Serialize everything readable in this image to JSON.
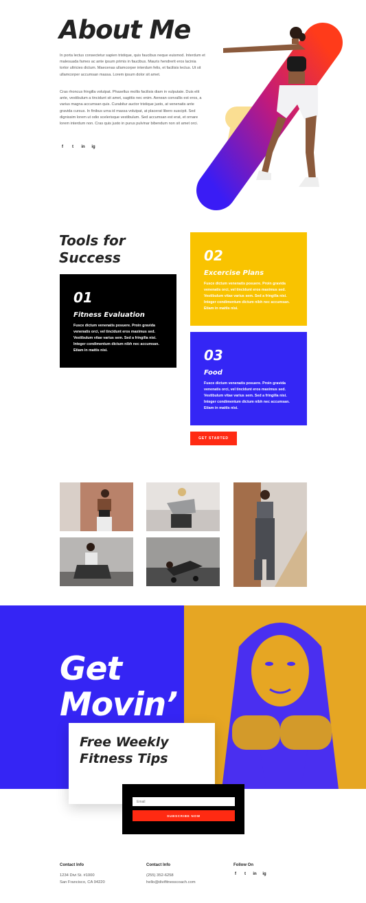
{
  "about": {
    "title": "About Me",
    "para1": "In porta lectus consectetur sapien tristique, quis faucibus neque euismod. Interdum et malesuada fames ac ante ipsum primis in faucibus. Mauris hendrerit eros lacinia tortor ultricies dictum. Maecenas ullamcorper interdum felis, et facilisis lectus. Ut sit ullamcorper accumsan massa. Lorem ipsum dolor sit amet.",
    "para2": "Cras rhoncus fringilla volutpat. Phasellus mollis facilisis diam in vulputate. Duis elit ante, vestibulum a tincidunt sit amet, sagittis nec enim. Aenean convallis est eros, a varius magna accumsan quis. Curabitur auctor tristique justo, at venenatis ante gravida cursus. In finibus urna id massa volutpat, at placerat libero suscipit. Sed dignissim lorem ut odio scelerisque vestibulum. Sed accumsan est erat, et ornare lorem interdum non. Cras quis justo in purus pulvinar bibendum non sit amet orci.",
    "social": [
      "f",
      "t",
      "in",
      "ig"
    ]
  },
  "tools": {
    "title": "Tools for Success",
    "cards": [
      {
        "num": "01",
        "title": "Fitness Evaluation",
        "text": "Fusce dictum venenatis posuere. Proin gravida venenatis orci, vel tincidunt eros maximus sed. Vestibulum vitae varius sem. Sed a fringilla nisi. Integer condimentum dictum nibh nec accumsan. Etiam in mattis nisi."
      },
      {
        "num": "02",
        "title": "Excercise Plans",
        "text": "Fusce dictum venenatis posuere. Proin gravida venenatis orci, vel tincidunt eros maximus sed. Vestibulum vitae varius sem. Sed a fringilla nisi. Integer condimentum dictum nibh nec accumsan. Etiam in mattis nisi."
      },
      {
        "num": "03",
        "title": "Food",
        "text": "Fusce dictum venenatis posuere. Proin gravida venenatis orci, vel tincidunt eros maximus sed. Vestibulum vitae varius sem. Sed a fringilla nisi. Integer condimentum dictum nibh nec accumsan. Etiam in mattis nisi."
      }
    ],
    "button": "GET STARTED"
  },
  "movin": {
    "title_line1": "Get",
    "title_line2": "Movin’",
    "tips_line1": "Free Weekly",
    "tips_line2": "Fitness Tips",
    "email_placeholder": "Email",
    "subscribe": "SUBSCRIBE NOW"
  },
  "footer": {
    "col1": {
      "head": "Contact Info",
      "line1": "1234 Divi St. #1000",
      "line2": "San Francisco, CA 94220"
    },
    "col2": {
      "head": "Contact Info",
      "line1": "(255) 352-6258",
      "line2": "hello@divifitnesscoach.com"
    },
    "col3": {
      "head": "Follow On",
      "social": [
        "f",
        "t",
        "in",
        "ig"
      ]
    }
  },
  "colors": {
    "blue": "#3525f4",
    "yellow": "#f9c300",
    "red": "#ff2a12",
    "black": "#000000"
  }
}
